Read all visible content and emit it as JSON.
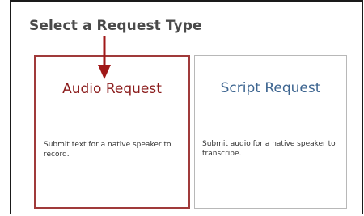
{
  "page": {
    "title": "Select a Request Type"
  },
  "cards": [
    {
      "title": "Audio Request",
      "description": "Submit text for a native speaker to record."
    },
    {
      "title": "Script Request",
      "description": "Submit audio for a native speaker to transcribe."
    }
  ],
  "colors": {
    "audio_accent": "#a03a3a",
    "audio_title": "#8b1c1c",
    "script_title": "#3d6590",
    "arrow": "#a01818"
  },
  "annotation": {
    "icon": "down-arrow-icon"
  }
}
